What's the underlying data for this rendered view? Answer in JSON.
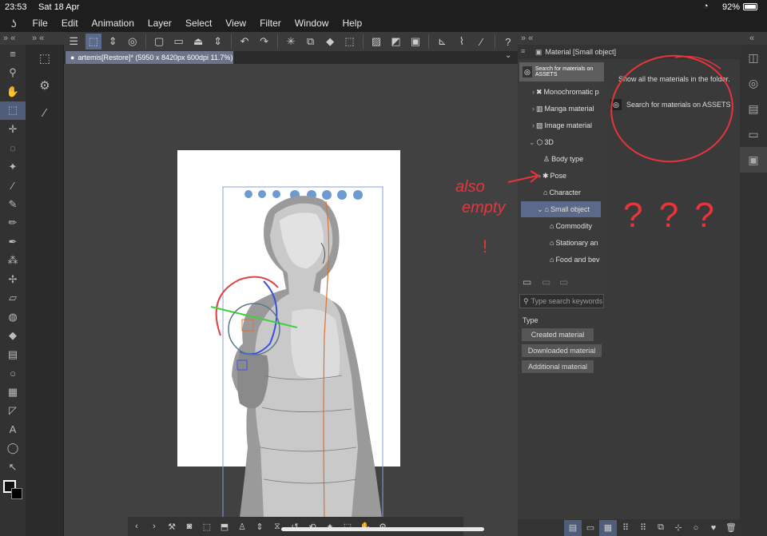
{
  "status": {
    "time": "23:53",
    "date": "Sat 18 Apr",
    "battery": "92%"
  },
  "menu": [
    "File",
    "Edit",
    "Animation",
    "Layer",
    "Select",
    "View",
    "Filter",
    "Window",
    "Help"
  ],
  "document": {
    "tab_title": "artemis[Restore]* (5950 x 8420px 600dpi 11.7%)"
  },
  "material_panel": {
    "title": "Material [Small object]",
    "search_assets_short": "Search for materials on ASSETS",
    "tree": [
      {
        "label": "Monochromatic p",
        "icon": "cross-icon"
      },
      {
        "label": "Manga material",
        "icon": "manga-icon"
      },
      {
        "label": "Image material",
        "icon": "image-icon"
      },
      {
        "label": "3D",
        "icon": "cube-icon"
      },
      {
        "label": "Body type",
        "icon": "body-icon"
      },
      {
        "label": "Pose",
        "icon": "pose-icon"
      },
      {
        "label": "Character",
        "icon": "bag-icon"
      },
      {
        "label": "Small object",
        "icon": "bag-icon"
      },
      {
        "label": "Commodity",
        "icon": "bag-icon"
      },
      {
        "label": "Stationary an",
        "icon": "bag-icon"
      },
      {
        "label": "Food and bev",
        "icon": "bag-icon"
      }
    ],
    "search_placeholder": "Type search keywords",
    "info_text": "Show all the materials in the folder.",
    "assets_link": "Search for materials on ASSETS",
    "type_label": "Type",
    "type_buttons": [
      "Created material",
      "Downloaded material",
      "Additional material"
    ]
  },
  "annotations": {
    "color": "#e8343a",
    "also": "also",
    "empty": "empty",
    "bang": "!",
    "questions": "? ? ?"
  },
  "colors": {
    "accent": "#5b6a8a",
    "panel": "#3a3a3a",
    "toolbar": "#1e1e1e"
  }
}
